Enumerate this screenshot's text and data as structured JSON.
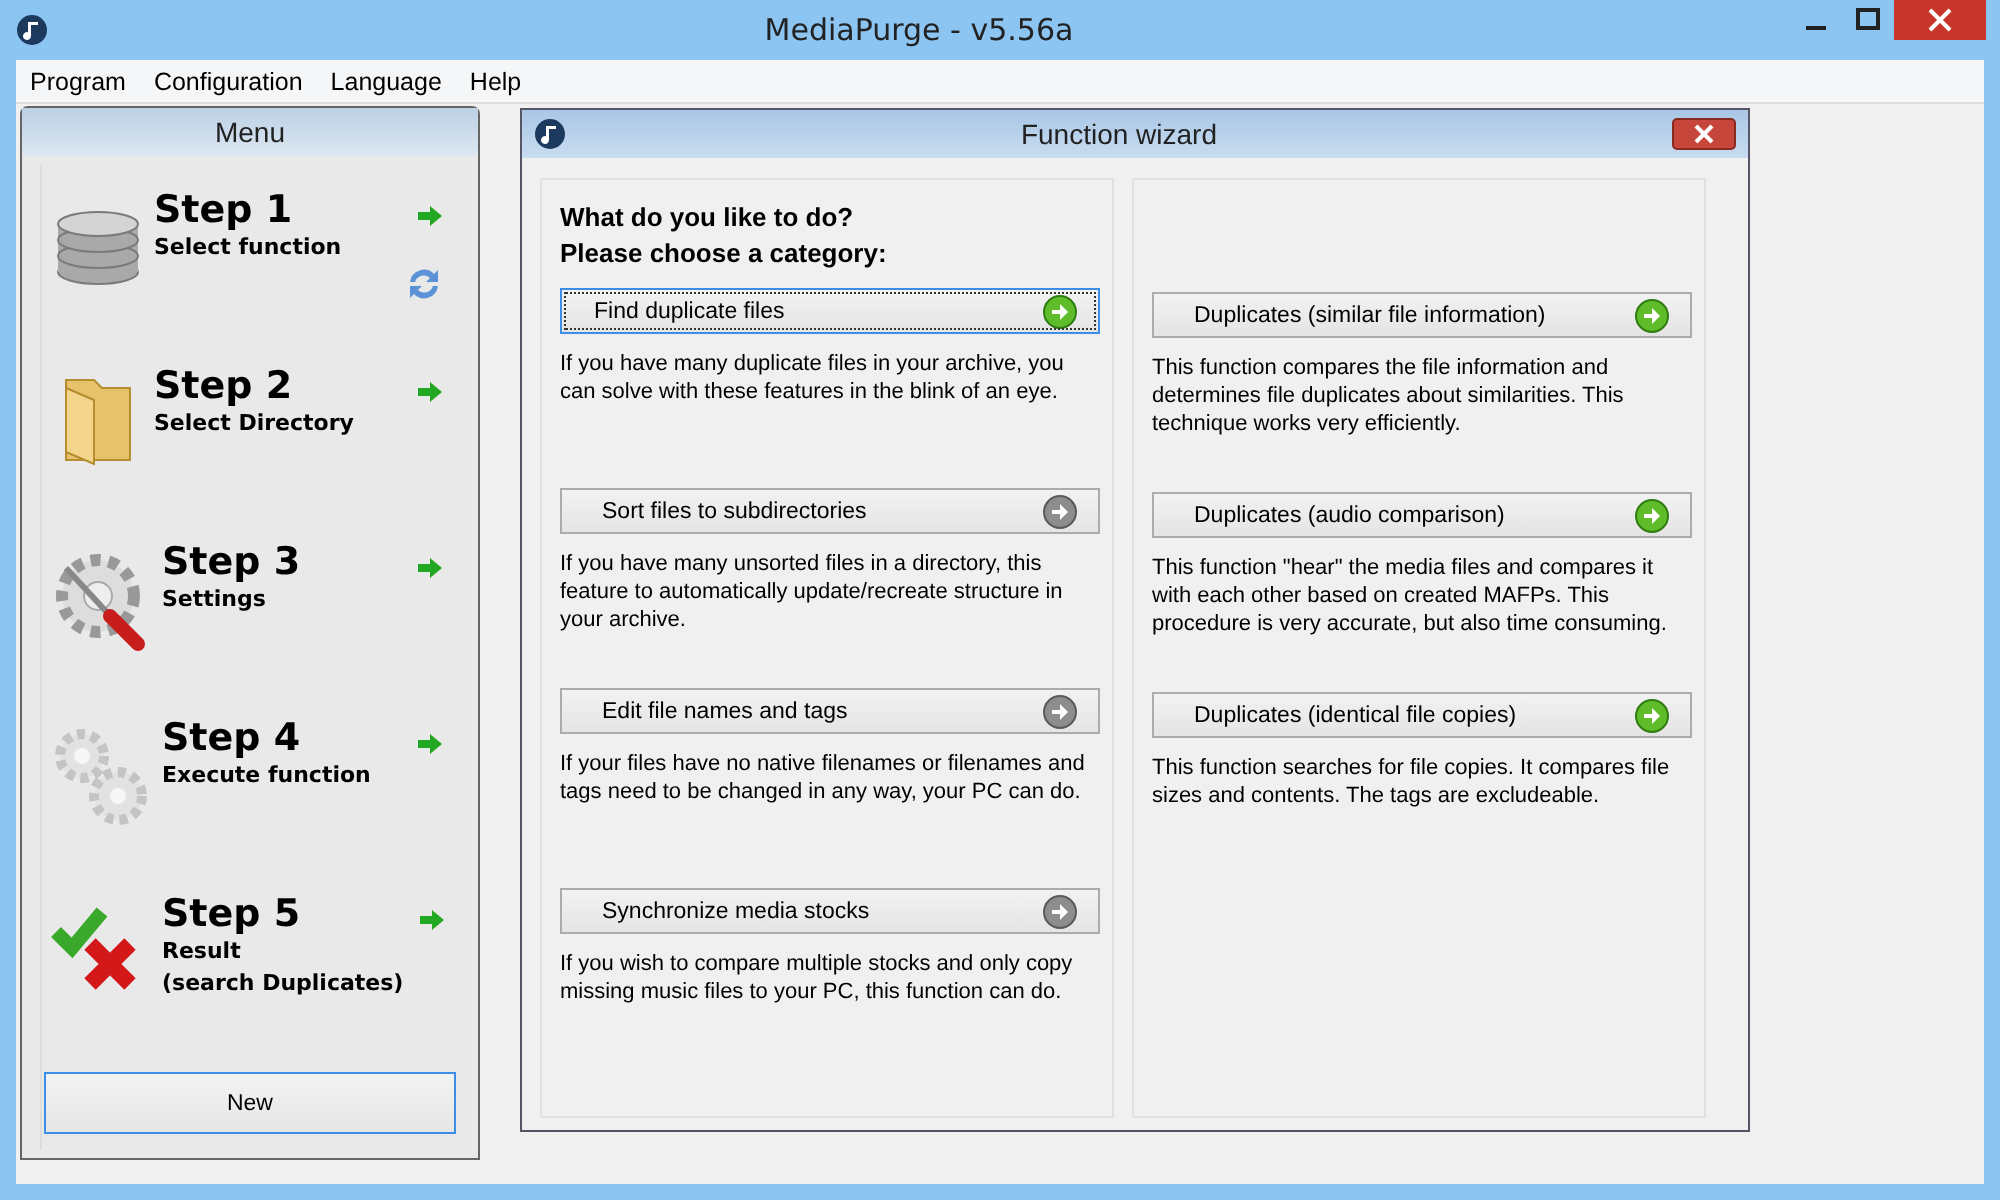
{
  "window": {
    "title": "MediaPurge - v5.56a"
  },
  "menu_bar": [
    "Program",
    "Configuration",
    "Language",
    "Help"
  ],
  "sidebar": {
    "title": "Menu",
    "steps": [
      {
        "kind": "database",
        "title": "Step 1",
        "subtitle": [
          "Select function"
        ],
        "refresh": true
      },
      {
        "kind": "folder",
        "title": "Step 2",
        "subtitle": [
          "Select Directory"
        ],
        "refresh": false
      },
      {
        "kind": "settings",
        "title": "Step 3",
        "subtitle": [
          "Settings"
        ],
        "refresh": false
      },
      {
        "kind": "gears",
        "title": "Step 4",
        "subtitle": [
          "Execute function"
        ],
        "refresh": false
      },
      {
        "kind": "result",
        "title": "Step 5",
        "subtitle": [
          "Result",
          "(search Duplicates)"
        ],
        "refresh": false
      }
    ],
    "new_button": "New"
  },
  "wizard": {
    "title": "Function wizard",
    "heading": [
      "What do you like to do?",
      "Please choose a category:"
    ],
    "left_options": [
      {
        "label": "Find duplicate files",
        "description": "If you have many duplicate files in your archive, you can solve with these features in the blink of an eye.",
        "enabled": true,
        "focused": true
      },
      {
        "label": "Sort files to subdirectories",
        "description": "If you have many unsorted files in a directory, this feature to automatically update/recreate structure in your archive.",
        "enabled": false,
        "focused": false
      },
      {
        "label": "Edit file names and tags",
        "description": "If your files have no native filenames or filenames and tags need to be changed in any way, your PC can do.",
        "enabled": false,
        "focused": false
      },
      {
        "label": "Synchronize media stocks",
        "description": "If you wish to compare multiple stocks and only copy missing music files to your PC, this function can do.",
        "enabled": false,
        "focused": false
      }
    ],
    "right_options": [
      {
        "label": "Duplicates (similar file information)",
        "description": "This function compares the file information and determines file duplicates about similarities. This technique works very efficiently.",
        "enabled": true,
        "focused": false
      },
      {
        "label": "Duplicates (audio comparison)",
        "description": "This function \"hear\" the media files and compares it with each other based on created MAFPs. This procedure is very accurate, but also time consuming.",
        "enabled": true,
        "focused": false
      },
      {
        "label": "Duplicates (identical file copies)",
        "description": "This function searches for file copies. It compares file sizes and contents. The tags are excludeable.",
        "enabled": true,
        "focused": false
      }
    ]
  }
}
